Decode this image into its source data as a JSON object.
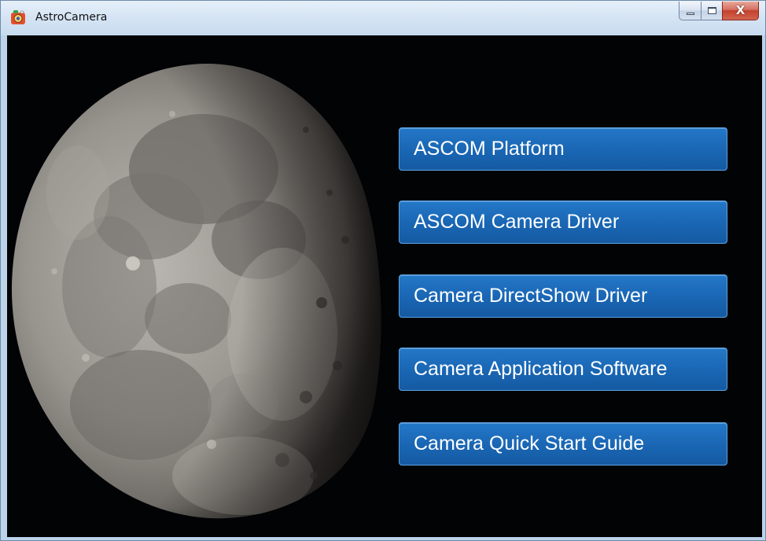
{
  "window": {
    "title": "AstroCamera",
    "icon": "astrocamera-app-icon",
    "controls": {
      "minimize_icon": "minimize-icon",
      "maximize_icon": "maximize-icon",
      "close_icon": "close-icon",
      "close_glyph": "X"
    }
  },
  "background": {
    "image": "moon-photo"
  },
  "menu": {
    "ascom_platform": "ASCOM Platform",
    "ascom_camera_driver": "ASCOM Camera Driver",
    "camera_directshow_driver": "Camera DirectShow Driver",
    "camera_application_software": "Camera Application Software",
    "camera_quick_start_guide": "Camera Quick Start Guide"
  },
  "colors": {
    "button_fill": "#1a67b5",
    "button_border": "#5ea3e3",
    "background": "#020305"
  }
}
